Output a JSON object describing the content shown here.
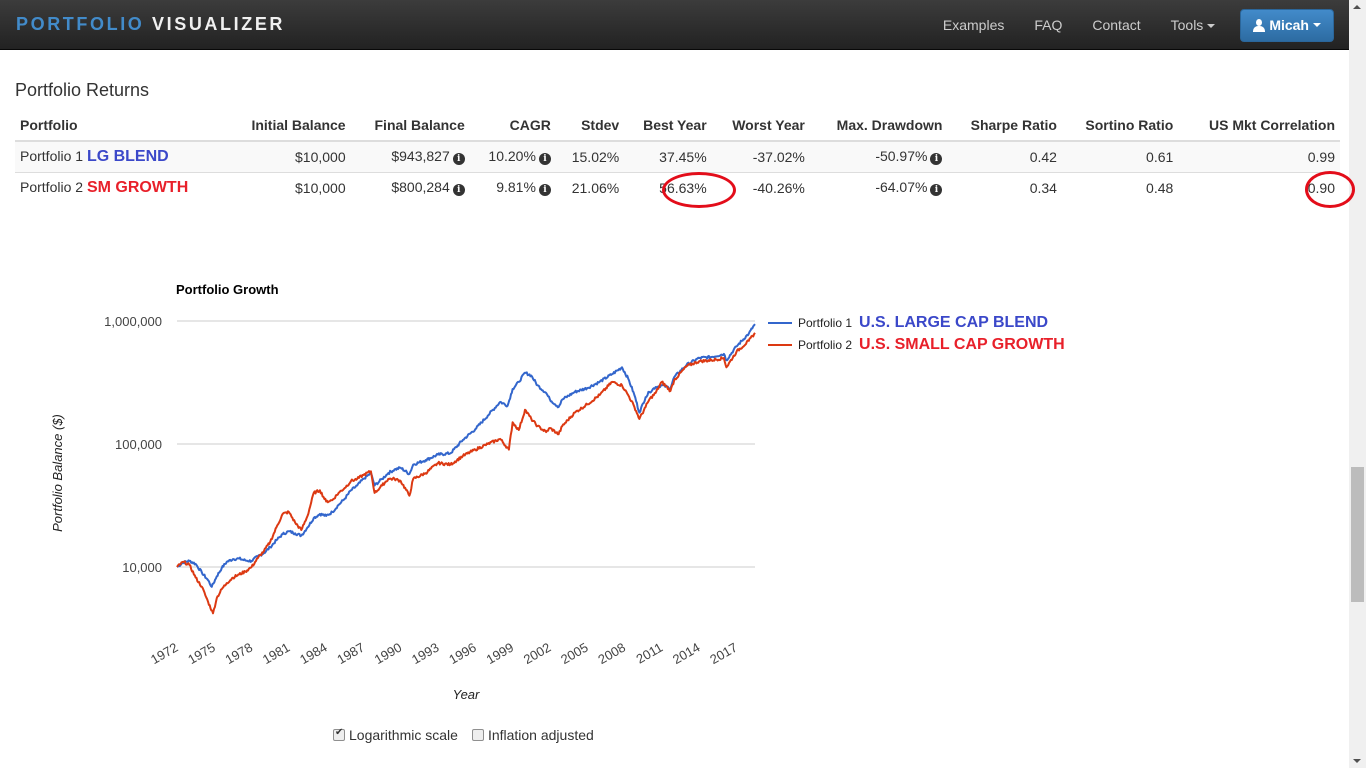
{
  "navbar": {
    "brand_part1": "PORTFOLIO",
    "brand_part2": "VISUALIZER",
    "links": [
      "Examples",
      "FAQ",
      "Contact"
    ],
    "tools_label": "Tools",
    "user_label": "Micah"
  },
  "returns": {
    "title": "Portfolio Returns",
    "columns": [
      "Portfolio",
      "Initial Balance",
      "Final Balance",
      "CAGR",
      "Stdev",
      "Best Year",
      "Worst Year",
      "Max. Drawdown",
      "Sharpe Ratio",
      "Sortino Ratio",
      "US Mkt Correlation"
    ],
    "rows": [
      {
        "portfolio": "Portfolio 1",
        "annotation": "LG BLEND",
        "initial": "$10,000",
        "final": "$943,827",
        "cagr": "10.20%",
        "stdev": "15.02%",
        "best": "37.45%",
        "worst": "-37.02%",
        "drawdown": "-50.97%",
        "sharpe": "0.42",
        "sortino": "0.61",
        "corr": "0.99"
      },
      {
        "portfolio": "Portfolio 2",
        "annotation": "SM GROWTH",
        "initial": "$10,000",
        "final": "$800,284",
        "cagr": "9.81%",
        "stdev": "21.06%",
        "best": "56.63%",
        "worst": "-40.26%",
        "drawdown": "-64.07%",
        "sharpe": "0.34",
        "sortino": "0.48",
        "corr": "0.90"
      }
    ],
    "info_glyph": "i"
  },
  "chart_data": {
    "type": "line",
    "title": "Portfolio Growth",
    "xlabel": "Year",
    "ylabel": "Portfolio Balance ($)",
    "yscale": "log",
    "ylim": [
      4000,
      1000000
    ],
    "yticks": [
      10000,
      100000,
      1000000
    ],
    "ytick_labels": [
      "10,000",
      "100,000",
      "1,000,000"
    ],
    "xlim": [
      1972,
      2018.5
    ],
    "xticks": [
      "1972",
      "1975",
      "1978",
      "1981",
      "1984",
      "1987",
      "1990",
      "1993",
      "1996",
      "1999",
      "2002",
      "2005",
      "2008",
      "2011",
      "2014",
      "2017"
    ],
    "grid": true,
    "legend_position": "right",
    "series": [
      {
        "name": "Portfolio 1",
        "annotation": "U.S. LARGE CAP BLEND",
        "color": "#3366cc",
        "x": [
          1972,
          1972.5,
          1973,
          1973.5,
          1974,
          1974.5,
          1974.8,
          1975.2,
          1975.6,
          1976,
          1976.5,
          1977,
          1977.5,
          1978,
          1978.5,
          1979,
          1979.5,
          1980,
          1980.5,
          1981,
          1981.5,
          1982,
          1982.5,
          1983,
          1983.5,
          1984,
          1984.5,
          1985,
          1985.5,
          1986,
          1986.5,
          1987,
          1987.6,
          1987.9,
          1988.5,
          1989,
          1989.5,
          1990,
          1990.7,
          1991,
          1992,
          1993,
          1994,
          1995,
          1996,
          1997,
          1998,
          1998.6,
          1999,
          1999.5,
          2000,
          2000.5,
          2001,
          2001.7,
          2002,
          2002.7,
          2003,
          2004,
          2005,
          2006,
          2007,
          2007.8,
          2008.3,
          2008.8,
          2009.2,
          2009.7,
          2010,
          2010.5,
          2011,
          2011.7,
          2012,
          2013,
          2014,
          2015,
          2016,
          2016.2,
          2017,
          2018,
          2018.5
        ],
        "y": [
          10000,
          10900,
          11200,
          10600,
          9000,
          7800,
          6900,
          8400,
          9800,
          11000,
          11600,
          11700,
          11300,
          11200,
          12200,
          13000,
          14500,
          16500,
          18500,
          19500,
          18800,
          18000,
          21000,
          25000,
          27000,
          26000,
          28000,
          32000,
          36000,
          42000,
          46000,
          52000,
          58000,
          46000,
          52000,
          58000,
          62000,
          64000,
          57000,
          68000,
          74000,
          82000,
          84000,
          108000,
          132000,
          170000,
          220000,
          205000,
          280000,
          320000,
          380000,
          360000,
          300000,
          260000,
          230000,
          200000,
          230000,
          265000,
          285000,
          320000,
          370000,
          420000,
          340000,
          250000,
          180000,
          240000,
          265000,
          290000,
          300000,
          285000,
          350000,
          440000,
          500000,
          510000,
          540000,
          480000,
          620000,
          790000,
          944000
        ]
      },
      {
        "name": "Portfolio 2",
        "annotation": "U.S. SMALL CAP GROWTH",
        "color": "#dc3912",
        "x": [
          1972,
          1972.5,
          1973,
          1973.5,
          1974,
          1974.5,
          1974.9,
          1975.2,
          1975.6,
          1976,
          1976.5,
          1977,
          1977.5,
          1978,
          1978.5,
          1979,
          1979.5,
          1980,
          1980.5,
          1981,
          1981.5,
          1982,
          1982.5,
          1983,
          1983.5,
          1984,
          1984.5,
          1985,
          1985.5,
          1986,
          1986.5,
          1987,
          1987.6,
          1987.9,
          1988.5,
          1989,
          1989.5,
          1990,
          1990.7,
          1991,
          1992,
          1993,
          1994,
          1995,
          1996,
          1997,
          1998,
          1998.7,
          1999,
          1999.5,
          2000,
          2000.5,
          2001,
          2001.7,
          2002,
          2002.7,
          2003,
          2004,
          2005,
          2006,
          2007,
          2007.8,
          2008.3,
          2008.8,
          2009.2,
          2009.7,
          2010,
          2010.5,
          2011,
          2011.7,
          2012,
          2013,
          2014,
          2015,
          2016,
          2016.2,
          2017,
          2018,
          2018.5
        ],
        "y": [
          10000,
          11000,
          10400,
          8200,
          6900,
          5200,
          4200,
          5600,
          6600,
          7400,
          8200,
          8700,
          9200,
          10000,
          11800,
          13500,
          16000,
          21000,
          27000,
          28000,
          23000,
          20000,
          26000,
          40000,
          42000,
          34000,
          35000,
          40000,
          44000,
          50000,
          52000,
          56000,
          60000,
          40000,
          46000,
          52000,
          52000,
          50000,
          38000,
          52000,
          58000,
          70000,
          68000,
          80000,
          90000,
          100000,
          110000,
          90000,
          150000,
          130000,
          190000,
          160000,
          140000,
          125000,
          135000,
          120000,
          140000,
          180000,
          210000,
          250000,
          320000,
          300000,
          250000,
          200000,
          160000,
          200000,
          230000,
          260000,
          320000,
          270000,
          330000,
          430000,
          470000,
          480000,
          500000,
          420000,
          560000,
          690000,
          800000
        ]
      }
    ]
  },
  "chart_options": {
    "log_scale_label": "Logarithmic scale",
    "log_scale_checked": true,
    "inflation_label": "Inflation adjusted",
    "inflation_checked": false
  }
}
